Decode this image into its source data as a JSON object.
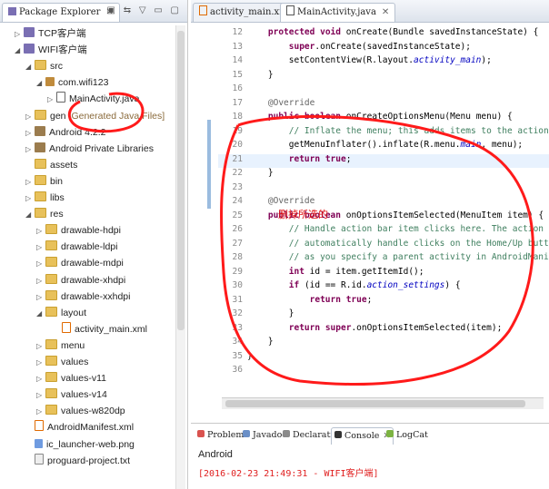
{
  "explorer": {
    "tab_label": "Package Explorer",
    "close": "✕",
    "toolbar_icons": "▣ ⇆ ▽ ▭ ▢",
    "items": [
      {
        "label": "TCP客户端",
        "icon": "project",
        "expanded": false
      },
      {
        "label": "WIFI客户端",
        "icon": "project",
        "expanded": true
      },
      {
        "label": "src",
        "icon": "folder",
        "expanded": true
      },
      {
        "label": "com.wifi123",
        "icon": "package",
        "expanded": true
      },
      {
        "label": "MainActivity.java",
        "icon": "java-file",
        "expanded": false
      },
      {
        "label": "gen",
        "icon": "folder",
        "suffix": "[Generated Java Files]",
        "expanded": false
      },
      {
        "label": "Android 4.2.2",
        "icon": "library",
        "expanded": false
      },
      {
        "label": "Android Private Libraries",
        "icon": "library",
        "expanded": false
      },
      {
        "label": "assets",
        "icon": "folder",
        "expanded": false
      },
      {
        "label": "bin",
        "icon": "folder",
        "expanded": false
      },
      {
        "label": "libs",
        "icon": "folder",
        "expanded": false
      },
      {
        "label": "res",
        "icon": "folder",
        "expanded": true
      },
      {
        "label": "drawable-hdpi",
        "icon": "folder",
        "expanded": false
      },
      {
        "label": "drawable-ldpi",
        "icon": "folder",
        "expanded": false
      },
      {
        "label": "drawable-mdpi",
        "icon": "folder",
        "expanded": false
      },
      {
        "label": "drawable-xhdpi",
        "icon": "folder",
        "expanded": false
      },
      {
        "label": "drawable-xxhdpi",
        "icon": "folder",
        "expanded": false
      },
      {
        "label": "layout",
        "icon": "folder",
        "expanded": true
      },
      {
        "label": "activity_main.xml",
        "icon": "xml-file",
        "expanded": false
      },
      {
        "label": "menu",
        "icon": "folder",
        "expanded": false
      },
      {
        "label": "values",
        "icon": "folder",
        "expanded": false
      },
      {
        "label": "values-v11",
        "icon": "folder",
        "expanded": false
      },
      {
        "label": "values-v14",
        "icon": "folder",
        "expanded": false
      },
      {
        "label": "values-w820dp",
        "icon": "folder",
        "expanded": false
      },
      {
        "label": "AndroidManifest.xml",
        "icon": "xml-file",
        "expanded": false
      },
      {
        "label": "ic_launcher-web.png",
        "icon": "png-file",
        "expanded": false
      },
      {
        "label": "proguard-project.txt",
        "icon": "text-file",
        "expanded": false
      }
    ]
  },
  "editor": {
    "tabs": [
      {
        "label": "activity_main.xml",
        "active": false
      },
      {
        "label": "MainActivity.java",
        "active": true
      }
    ],
    "tab_close": "✕",
    "lines": [
      {
        "n": "12",
        "text": "    protected void onCreate(Bundle savedInstanceState) {"
      },
      {
        "n": "13",
        "text": "        super.onCreate(savedInstanceState);"
      },
      {
        "n": "14",
        "text": "        setContentView(R.layout.activity_main);"
      },
      {
        "n": "15",
        "text": "    }"
      },
      {
        "n": "16",
        "text": ""
      },
      {
        "n": "17",
        "text": "    @Override"
      },
      {
        "n": "18",
        "text": "    public boolean onCreateOptionsMenu(Menu menu) {"
      },
      {
        "n": "19",
        "text": "        // Inflate the menu; this adds items to the action bar if it is p"
      },
      {
        "n": "20",
        "text": "        getMenuInflater().inflate(R.menu.main, menu);"
      },
      {
        "n": "21",
        "text": "        return true;"
      },
      {
        "n": "22",
        "text": "    }"
      },
      {
        "n": "23",
        "text": ""
      },
      {
        "n": "24",
        "text": "    @Override"
      },
      {
        "n": "25",
        "text": "    public boolean onOptionsItemSelected(MenuItem item) {"
      },
      {
        "n": "26",
        "text": "        // Handle action bar item clicks here. The action bar wi"
      },
      {
        "n": "27",
        "text": "        // automatically handle clicks on the Home/Up button, so long"
      },
      {
        "n": "28",
        "text": "        // as you specify a parent activity in AndroidManifest.xml."
      },
      {
        "n": "29",
        "text": "        int id = item.getItemId();"
      },
      {
        "n": "30",
        "text": "        if (id == R.id.action_settings) {"
      },
      {
        "n": "31",
        "text": "            return true;"
      },
      {
        "n": "32",
        "text": "        }"
      },
      {
        "n": "33",
        "text": "        return super.onOptionsItemSelected(item);"
      },
      {
        "n": "34",
        "text": "    }"
      },
      {
        "n": "35",
        "text": "}"
      },
      {
        "n": "36",
        "text": ""
      }
    ],
    "annotation": "删掉所选的"
  },
  "console": {
    "tabs": [
      {
        "label": "Problems",
        "active": false
      },
      {
        "label": "Javadoc",
        "active": false
      },
      {
        "label": "Declaration",
        "active": false
      },
      {
        "label": "Console",
        "active": true
      },
      {
        "label": "LogCat",
        "active": false
      }
    ],
    "title": "Android",
    "output": "[2016-02-23 21:49:31 - WIFI客户端]"
  },
  "colors": {
    "keyword": "#7f0055",
    "comment": "#3f7f5f",
    "field": "#0000c0",
    "annotation_red": "#e01010"
  }
}
